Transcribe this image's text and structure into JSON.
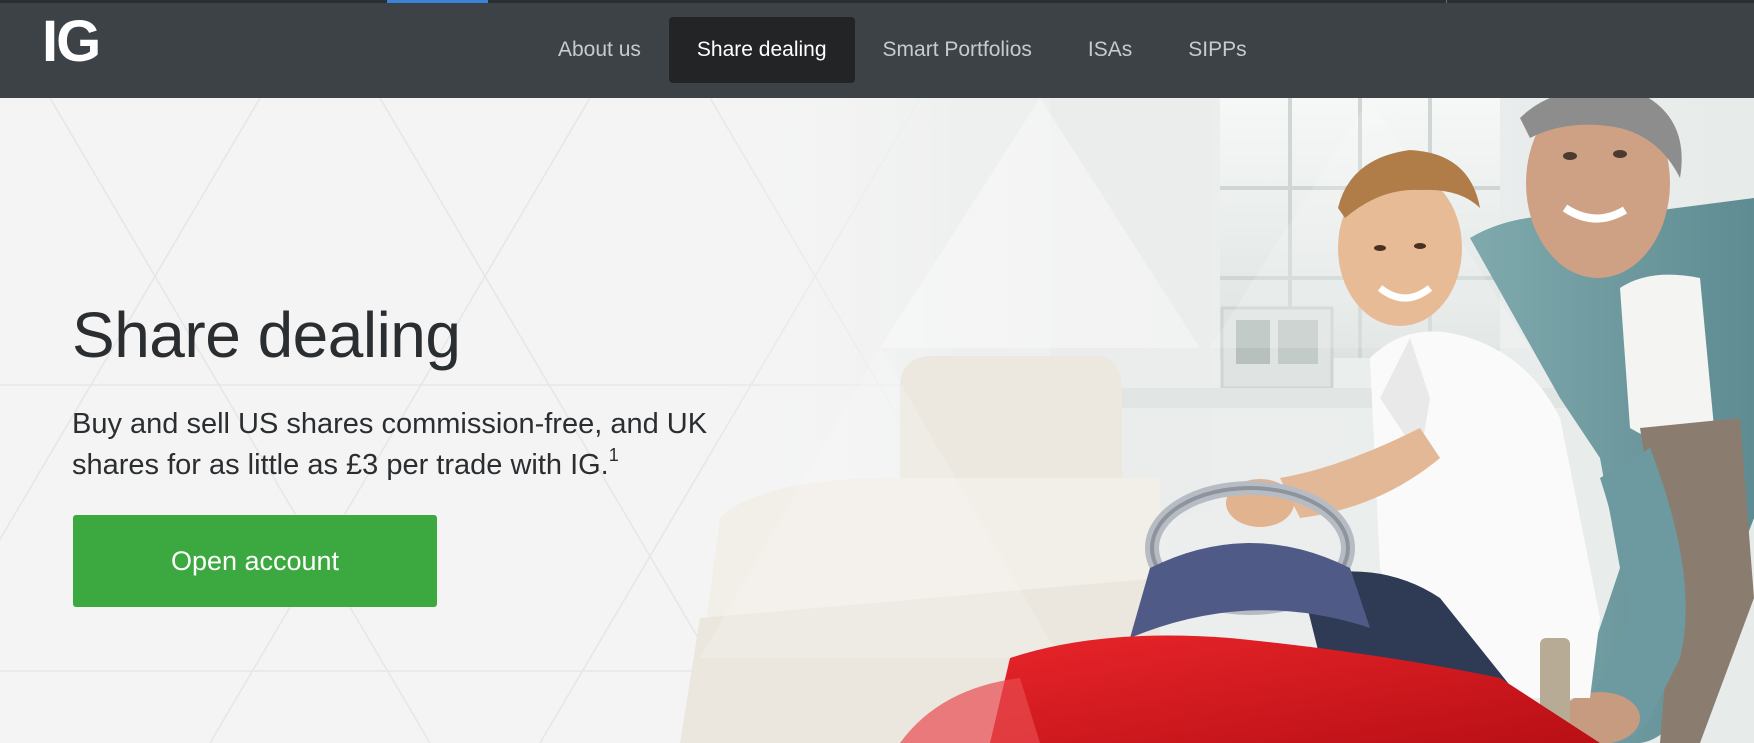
{
  "header": {
    "logo_text": "IG",
    "nav": [
      {
        "label": "About us",
        "active": false
      },
      {
        "label": "Share dealing",
        "active": true
      },
      {
        "label": "Smart Portfolios",
        "active": false
      },
      {
        "label": "ISAs",
        "active": false
      },
      {
        "label": "SIPPs",
        "active": false
      }
    ]
  },
  "hero": {
    "title": "Share dealing",
    "text": "Buy and sell US shares commission-free, and UK shares for as little as £3 per trade with IG.",
    "footnote_marker": "1",
    "cta_label": "Open account",
    "photo_description_icon": "father-and-son-toy-car-photo"
  },
  "colors": {
    "nav_bg": "#3d4247",
    "nav_active_bg": "#222426",
    "accent": "#3b82d6",
    "cta": "#3ba93f",
    "car_red": "#d9141b"
  }
}
